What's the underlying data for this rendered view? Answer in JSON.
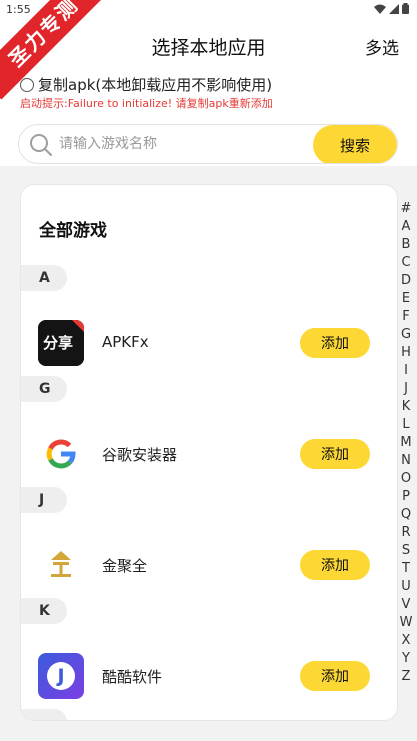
{
  "status": {
    "time": "1:55"
  },
  "ribbon": {
    "text": "圣力专测"
  },
  "header": {
    "title": "选择本地应用",
    "multi_select": "多选"
  },
  "copy_option": {
    "label": "复制apk(本地卸载应用不影响使用)",
    "hint": "启动提示:Failure to initialize! 请复制apk重新添加"
  },
  "search": {
    "placeholder": "请输入游戏名称",
    "value": "",
    "button": "搜索"
  },
  "list": {
    "title": "全部游戏",
    "sections": [
      {
        "letter": "A",
        "app": {
          "name": "APKFx",
          "icon": "apkfx-share-icon",
          "add": "添加"
        }
      },
      {
        "letter": "G",
        "app": {
          "name": "谷歌安装器",
          "icon": "google-g-icon",
          "add": "添加"
        }
      },
      {
        "letter": "J",
        "app": {
          "name": "金聚全",
          "icon": "jinjuquan-gold-icon",
          "add": "添加"
        }
      },
      {
        "letter": "K",
        "app": {
          "name": "酷酷软件",
          "icon": "kuku-j-icon",
          "add": "添加"
        }
      }
    ]
  },
  "apkfx_icon_text": "分享",
  "kuku_icon_text": "J",
  "index_letters": [
    "#",
    "A",
    "B",
    "C",
    "D",
    "E",
    "F",
    "G",
    "H",
    "I",
    "J",
    "K",
    "L",
    "M",
    "N",
    "O",
    "P",
    "Q",
    "R",
    "S",
    "T",
    "U",
    "V",
    "W",
    "X",
    "Y",
    "Z"
  ],
  "colors": {
    "accent": "#fdd835",
    "ribbon": "#e0262a",
    "hint": "#e53935"
  }
}
